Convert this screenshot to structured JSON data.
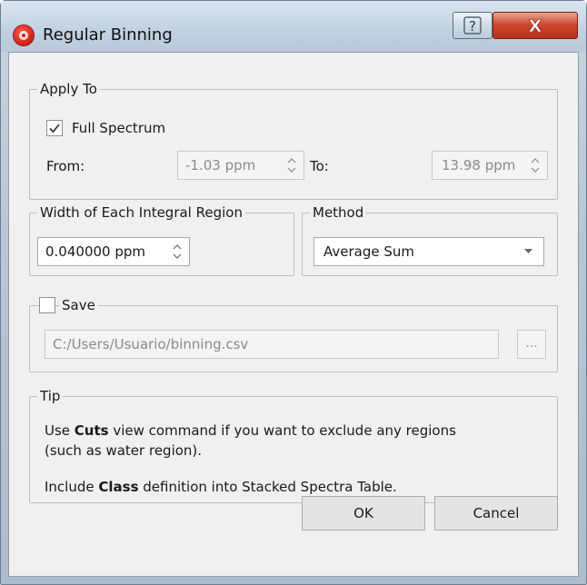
{
  "window": {
    "title": "Regular Binning",
    "help_label": "?",
    "close_label": "X"
  },
  "apply_to": {
    "legend": "Apply To",
    "full_spectrum_label": "Full Spectrum",
    "full_spectrum_checked": true,
    "from_label": "From:",
    "from_value": "-1.03 ppm",
    "to_label": "To:",
    "to_value": "13.98 ppm"
  },
  "width_region": {
    "legend": "Width of Each Integral Region",
    "value": "0.040000 ppm"
  },
  "method": {
    "legend": "Method",
    "selected": "Average Sum"
  },
  "save": {
    "legend": "Save",
    "checked": false,
    "path": "C:/Users/Usuario/binning.csv",
    "browse_label": "..."
  },
  "tip": {
    "legend": "Tip",
    "line1_pre": "Use ",
    "line1_bold": "Cuts",
    "line1_post": " view command if you want to exclude any regions",
    "line2": "(such as water region).",
    "line3_pre": "Include ",
    "line3_bold": "Class",
    "line3_post": " definition into Stacked Spectra Table."
  },
  "buttons": {
    "ok_label": "OK",
    "cancel_label": "Cancel"
  },
  "colors": {
    "close_button": "#c8412a",
    "app_icon": "#d7281e"
  }
}
